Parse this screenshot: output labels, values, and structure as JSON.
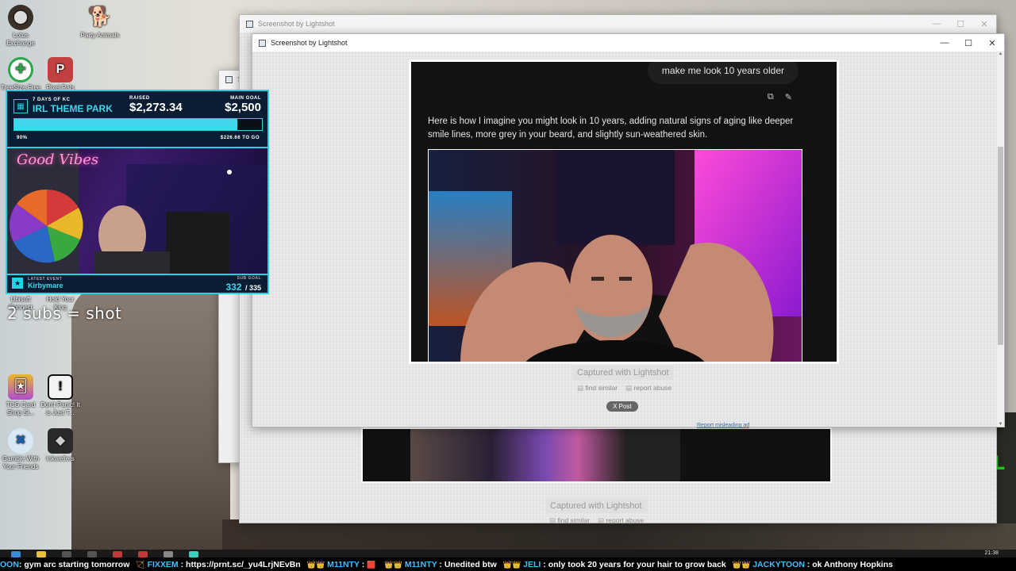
{
  "desktop": {
    "icons": [
      {
        "label": "Lotus Exchange",
        "glyph": "⬤",
        "color": "#5b4a3a"
      },
      {
        "label": "Party Animals",
        "glyph": "🐕",
        "color": "transparent"
      },
      {
        "label": "TreeSize Free",
        "glyph": "✚",
        "color": "#2aa84a"
      },
      {
        "label": "Pixel Pals",
        "glyph": "P",
        "color": "#c24040"
      },
      {
        "label": "Ubisoft Connect",
        "glyph": "",
        "color": "transparent"
      },
      {
        "label": "Hold Your King",
        "glyph": "",
        "color": "transparent"
      },
      {
        "label": "TCG Card Shop Si...",
        "glyph": "🃏",
        "color": "#6a3fb0"
      },
      {
        "label": "Don't Panic! It is Just T...",
        "glyph": "!",
        "color": "#222"
      },
      {
        "label": "Gamble With Your Friends",
        "glyph": "✖",
        "color": "#1b5fa8"
      },
      {
        "label": "Inkwellers",
        "glyph": "◆",
        "color": "#2a2a2a"
      }
    ]
  },
  "back_window": {
    "title": "Screenshot by Lightshot",
    "captured_label": "Captured with Lightshot",
    "find_similar": "find similar",
    "report_abuse": "report abuse"
  },
  "main_window": {
    "title": "Screenshot by Lightshot",
    "controls": {
      "minimize": "—",
      "maximize": "☐",
      "close": "✕"
    },
    "chat": {
      "user_message": "make me look 10 years older",
      "reply": "Here is how I imagine you might look in 10 years, adding natural signs of aging like deeper smile lines, more grey in your beard, and slightly sun-weathered skin."
    },
    "captured_label": "Captured with Lightshot",
    "find_similar": "find similar",
    "report_abuse": "report abuse",
    "x_post": "X Post",
    "report_ad": "Report misleading ad"
  },
  "overlay": {
    "days_label": "7 DAYS OF KC",
    "event_title": "IRL THEME PARK",
    "raised_label": "RAISED",
    "raised_value": "$2,273.34",
    "goal_label": "MAIN GOAL",
    "goal_value": "$2,500",
    "percent": "90%",
    "progress": 0.9,
    "to_go": "$226.66 TO GO",
    "neon_sign": "Good Vibes",
    "latest_event_label": "LATEST EVENT",
    "latest_event_name": "Kirbymare",
    "sub_goal_label": "SUB GOAL",
    "sub_current": "332",
    "sub_goal": "/ 335"
  },
  "subs_text": "2 subs = shot",
  "ticker": [
    {
      "user": "",
      "text": "gym arc starting tomorrow"
    },
    {
      "user": "FIXXEM",
      "text": "https://prnt.sc/_yu4LrjNEvBn"
    },
    {
      "user": "M11NTY",
      "text": ""
    },
    {
      "user": "M11NTY",
      "text": "Unedited btw"
    },
    {
      "user": "JELI",
      "text": "only took 20 years for your hair to grow back"
    },
    {
      "user": "JACKYTOON",
      "text": "ok Anthony Hopkins"
    }
  ],
  "ticker_prefix": "OON",
  "clock": {
    "time": "21:38"
  }
}
